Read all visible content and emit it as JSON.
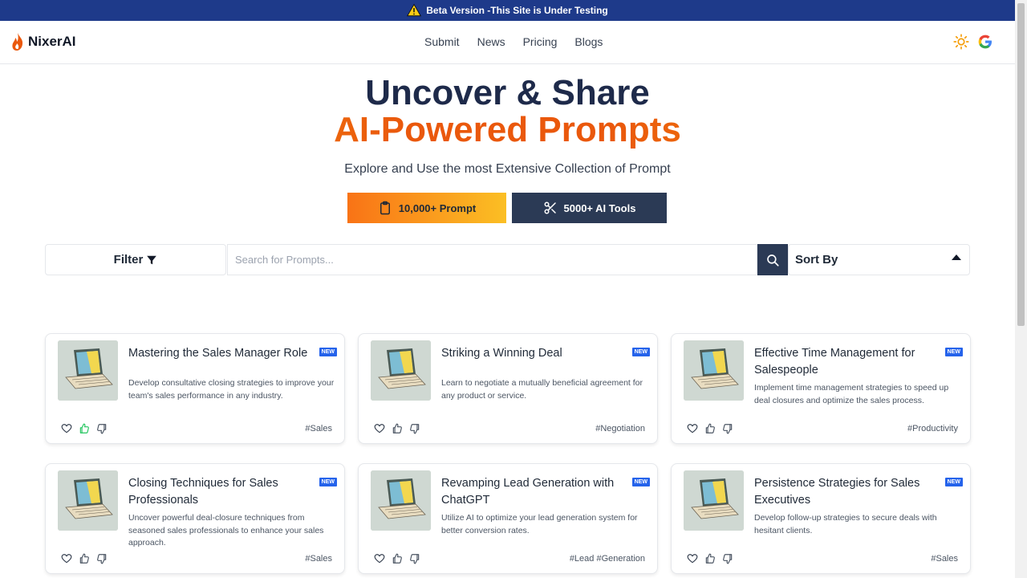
{
  "beta_banner": {
    "text": "Beta Version -This Site is Under Testing"
  },
  "brand": {
    "name": "NixerAI"
  },
  "nav": {
    "items": [
      "Submit",
      "News",
      "Pricing",
      "Blogs"
    ]
  },
  "hero": {
    "line1": "Uncover & Share",
    "line2": "AI-Powered Prompts",
    "subtitle": "Explore and Use the most Extensive Collection of Prompt",
    "prompt_button": "10,000+ Prompt",
    "tools_button": "5000+ AI Tools"
  },
  "toolbar": {
    "filter_label": "Filter",
    "search_placeholder": "Search for Prompts...",
    "sort_label": "Sort By"
  },
  "colors": {
    "accent_orange": "#ea580c",
    "navy": "#2b3a55",
    "banner_blue": "#1e3a8a",
    "new_badge": "#2563eb"
  },
  "cards": [
    {
      "title": "Mastering the Sales Manager Role",
      "badge": "NEW",
      "description": "Develop consultative closing strategies to improve your team's sales performance in any industry.",
      "tag": "#Sales",
      "liked": true
    },
    {
      "title": "Striking a Winning Deal",
      "badge": "NEW",
      "description": "Learn to negotiate a mutually beneficial agreement for any product or service.",
      "tag": "#Negotiation",
      "liked": false
    },
    {
      "title": "Effective Time Management for Salespeople",
      "badge": "NEW",
      "description": "Implement time management strategies to speed up deal closures and optimize the sales process.",
      "tag": "#Productivity",
      "liked": false
    },
    {
      "title": "Closing Techniques for Sales Professionals",
      "badge": "NEW",
      "description": "Uncover powerful deal-closure techniques from seasoned sales professionals to enhance your sales approach.",
      "tag": "#Sales",
      "liked": false
    },
    {
      "title": "Revamping Lead Generation with ChatGPT",
      "badge": "NEW",
      "description": "Utilize AI to optimize your lead generation system for better conversion rates.",
      "tag": "#Lead #Generation",
      "liked": false
    },
    {
      "title": "Persistence Strategies for Sales Executives",
      "badge": "NEW",
      "description": "Develop follow-up strategies to secure deals with hesitant clients.",
      "tag": "#Sales",
      "liked": false
    }
  ]
}
